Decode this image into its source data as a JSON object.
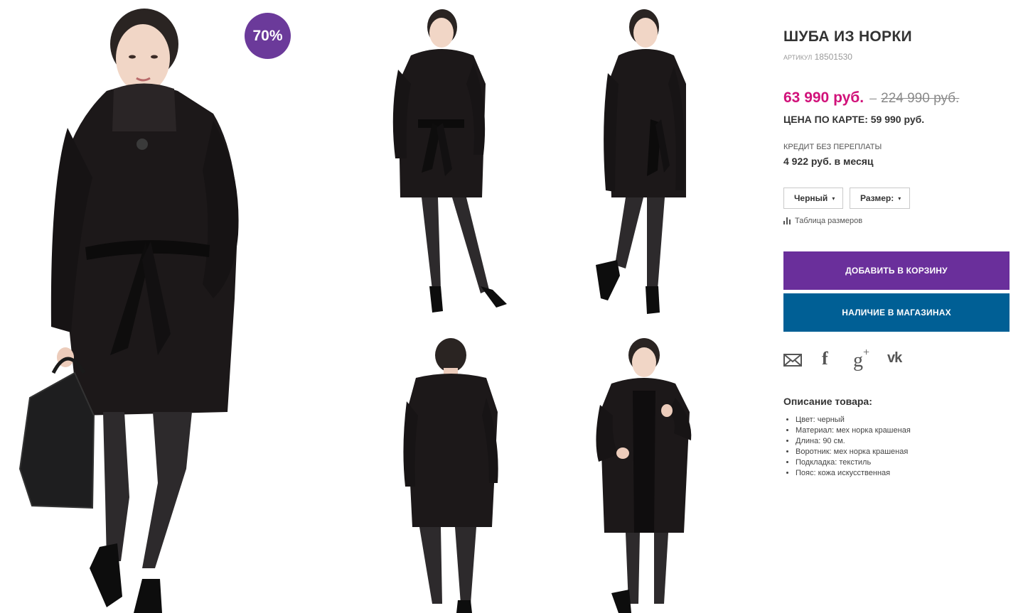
{
  "badge": {
    "discount": "70%"
  },
  "product": {
    "title": "ШУБА ИЗ НОРКИ",
    "sku_label": "артикул",
    "sku_value": "18501530",
    "price_new": "63 990 руб.",
    "price_separator": "–",
    "price_old": "224 990 руб.",
    "card_price": "ЦЕНА ПО КАРТЕ: 59 990 руб.",
    "credit_label": "КРЕДИТ БЕЗ ПЕРЕПЛАТЫ",
    "credit_value": "4 922 руб. в месяц"
  },
  "options": {
    "color_selected": "Черный",
    "size_selected": "Размер:",
    "arrow": "▾"
  },
  "size_table_link": "Таблица размеров",
  "buttons": {
    "add_to_cart": "ДОБАВИТЬ В КОРЗИНУ",
    "availability": "НАЛИЧИЕ В МАГАЗИНАХ"
  },
  "social": {
    "icons": [
      "mail-icon",
      "facebook-icon",
      "google-plus-icon",
      "vk-icon"
    ],
    "facebook_glyph": "f",
    "google_glyph": "g",
    "google_plus_glyph": "+",
    "vk_glyph": "vk"
  },
  "description": {
    "title": "Описание товара:",
    "items": [
      "Цвет: черный",
      "Материал: мех норка крашеная",
      "Длина: 90 см.",
      "Воротник: мех норка крашеная",
      "Подкладка: текстиль",
      "Пояс: кожа искусственная"
    ]
  },
  "colors": {
    "accent_pink": "#d1127a",
    "cart_button": "#6a2f9b",
    "stores_button": "#005f95",
    "badge": "#6b3a9a"
  }
}
